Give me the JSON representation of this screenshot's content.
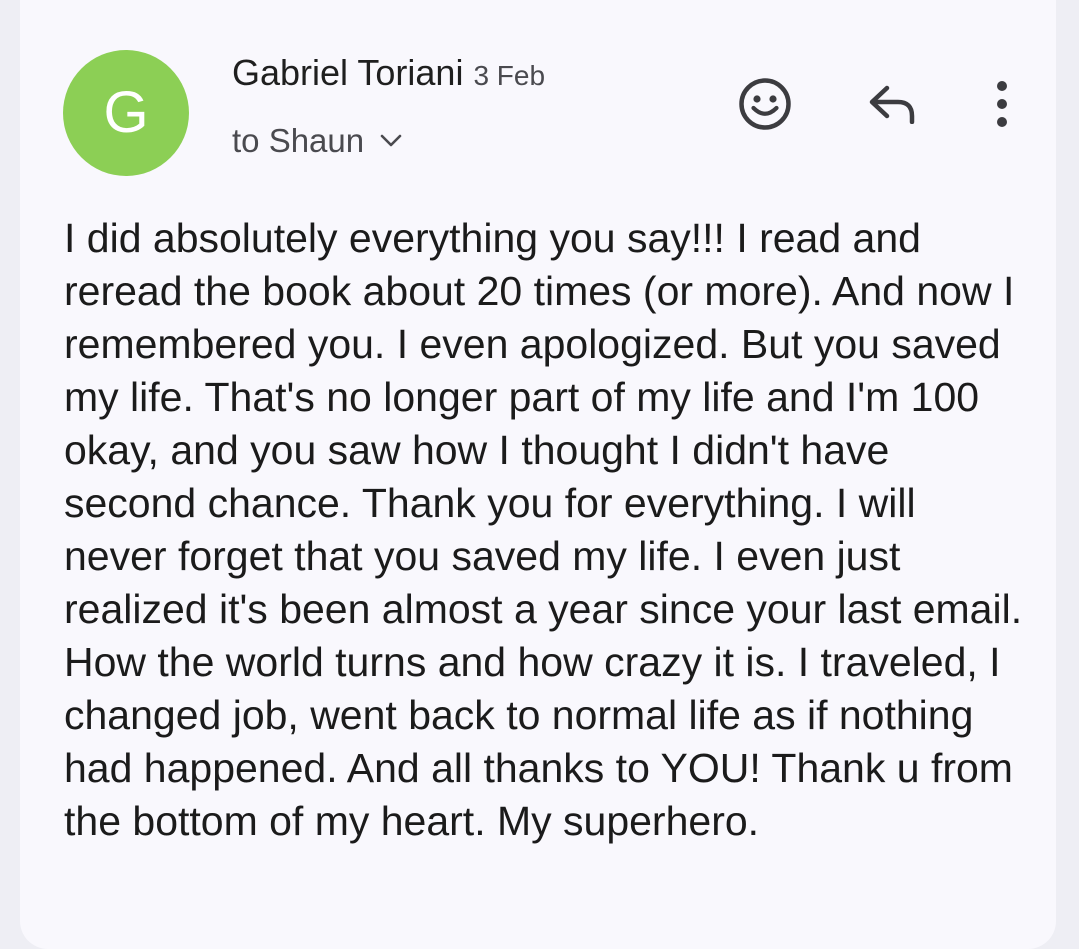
{
  "email": {
    "avatar_letter": "G",
    "avatar_color": "#8ccf55",
    "sender_name": "Gabriel Toriani",
    "date": "3 Feb",
    "recipient_text": "to Shaun",
    "actions": {
      "react_icon": "emoji-smile-icon",
      "reply_icon": "reply-arrow-icon",
      "more_icon": "vertical-dots-icon"
    },
    "body": "I did absolutely everything you say!!! I read and reread the book about 20 times (or more). And now I remembered you. I even apologized. But you saved my life. That's no longer part of my life and I'm 100 okay, and you saw how I thought I didn't have second chance. Thank you for everything. I will never forget that you saved my life. I even just realized it's been almost a year since your last email. How the world turns and how crazy it is. I traveled, I changed job, went back to normal life as if nothing had happened. And all thanks to YOU! Thank u from the bottom of my heart. My superhero."
  }
}
